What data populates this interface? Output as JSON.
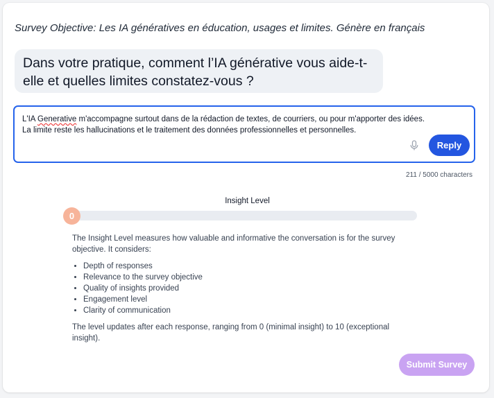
{
  "survey": {
    "objective": "Survey Objective: Les IA génératives en éducation, usages et limites. Génère en français"
  },
  "question": {
    "text": "Dans votre pratique, comment l’IA générative vous aide-t-elle et quelles limites constatez-vous ?"
  },
  "answer": {
    "prefix": "L'IA ",
    "misspelled": "Generative",
    "rest": " m'accompagne surtout dans de la rédaction de textes, de courriers, ou pour m'apporter des idées. La limite reste les hallucinations et le traitement des données professionnelles et personnelles.",
    "reply_label": "Reply",
    "char_count": "211 / 5000 characters",
    "mic_icon": "microphone-icon"
  },
  "insight": {
    "title": "Insight Level",
    "level": "0",
    "level_fraction": 0,
    "description": "The Insight Level measures how valuable and informative the conversation is for the survey objective. It considers:",
    "criteria": [
      "Depth of responses",
      "Relevance to the survey objective",
      "Quality of insights provided",
      "Engagement level",
      "Clarity of communication"
    ],
    "footer": "The level updates after each response, ranging from 0 (minimal insight) to 10 (exceptional insight)."
  },
  "actions": {
    "submit_label": "Submit Survey"
  },
  "colors": {
    "accent": "#2356e0",
    "focus_border": "#2563eb",
    "level_knob": "#f7b49a",
    "submit_disabled": "#c9a3f2"
  }
}
